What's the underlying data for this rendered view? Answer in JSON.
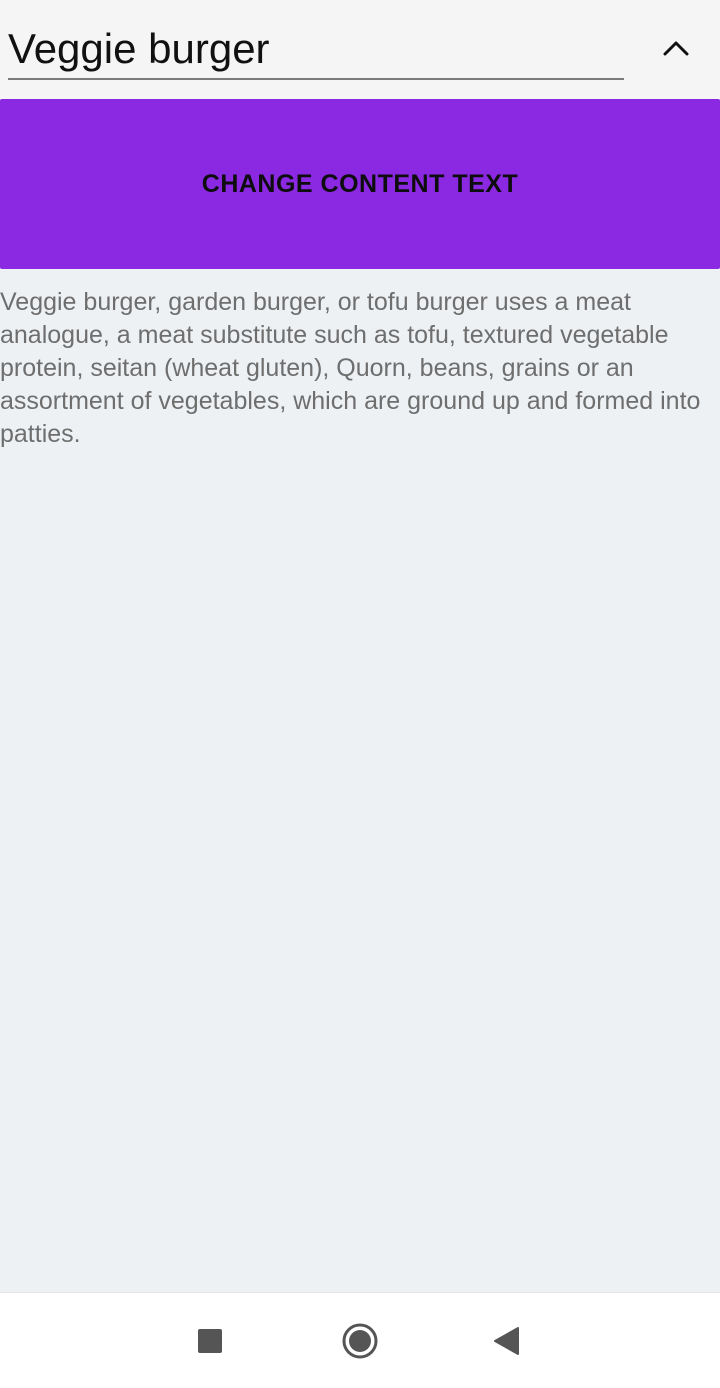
{
  "header": {
    "title": "Veggie burger",
    "collapse_icon": "chevron-up-icon"
  },
  "action_button": {
    "label": "CHANGE CONTENT TEXT",
    "color": "#8a28e2"
  },
  "content": {
    "text": "Veggie burger, garden burger, or tofu burger uses a meat analogue, a meat substitute such as tofu, textured vegetable protein, seitan (wheat gluten), Quorn, beans, grains or an assortment of vegetables, which are ground up and formed into patties."
  },
  "nav_bar": {
    "recent_icon": "square-icon",
    "home_icon": "circle-icon",
    "back_icon": "triangle-back-icon"
  }
}
